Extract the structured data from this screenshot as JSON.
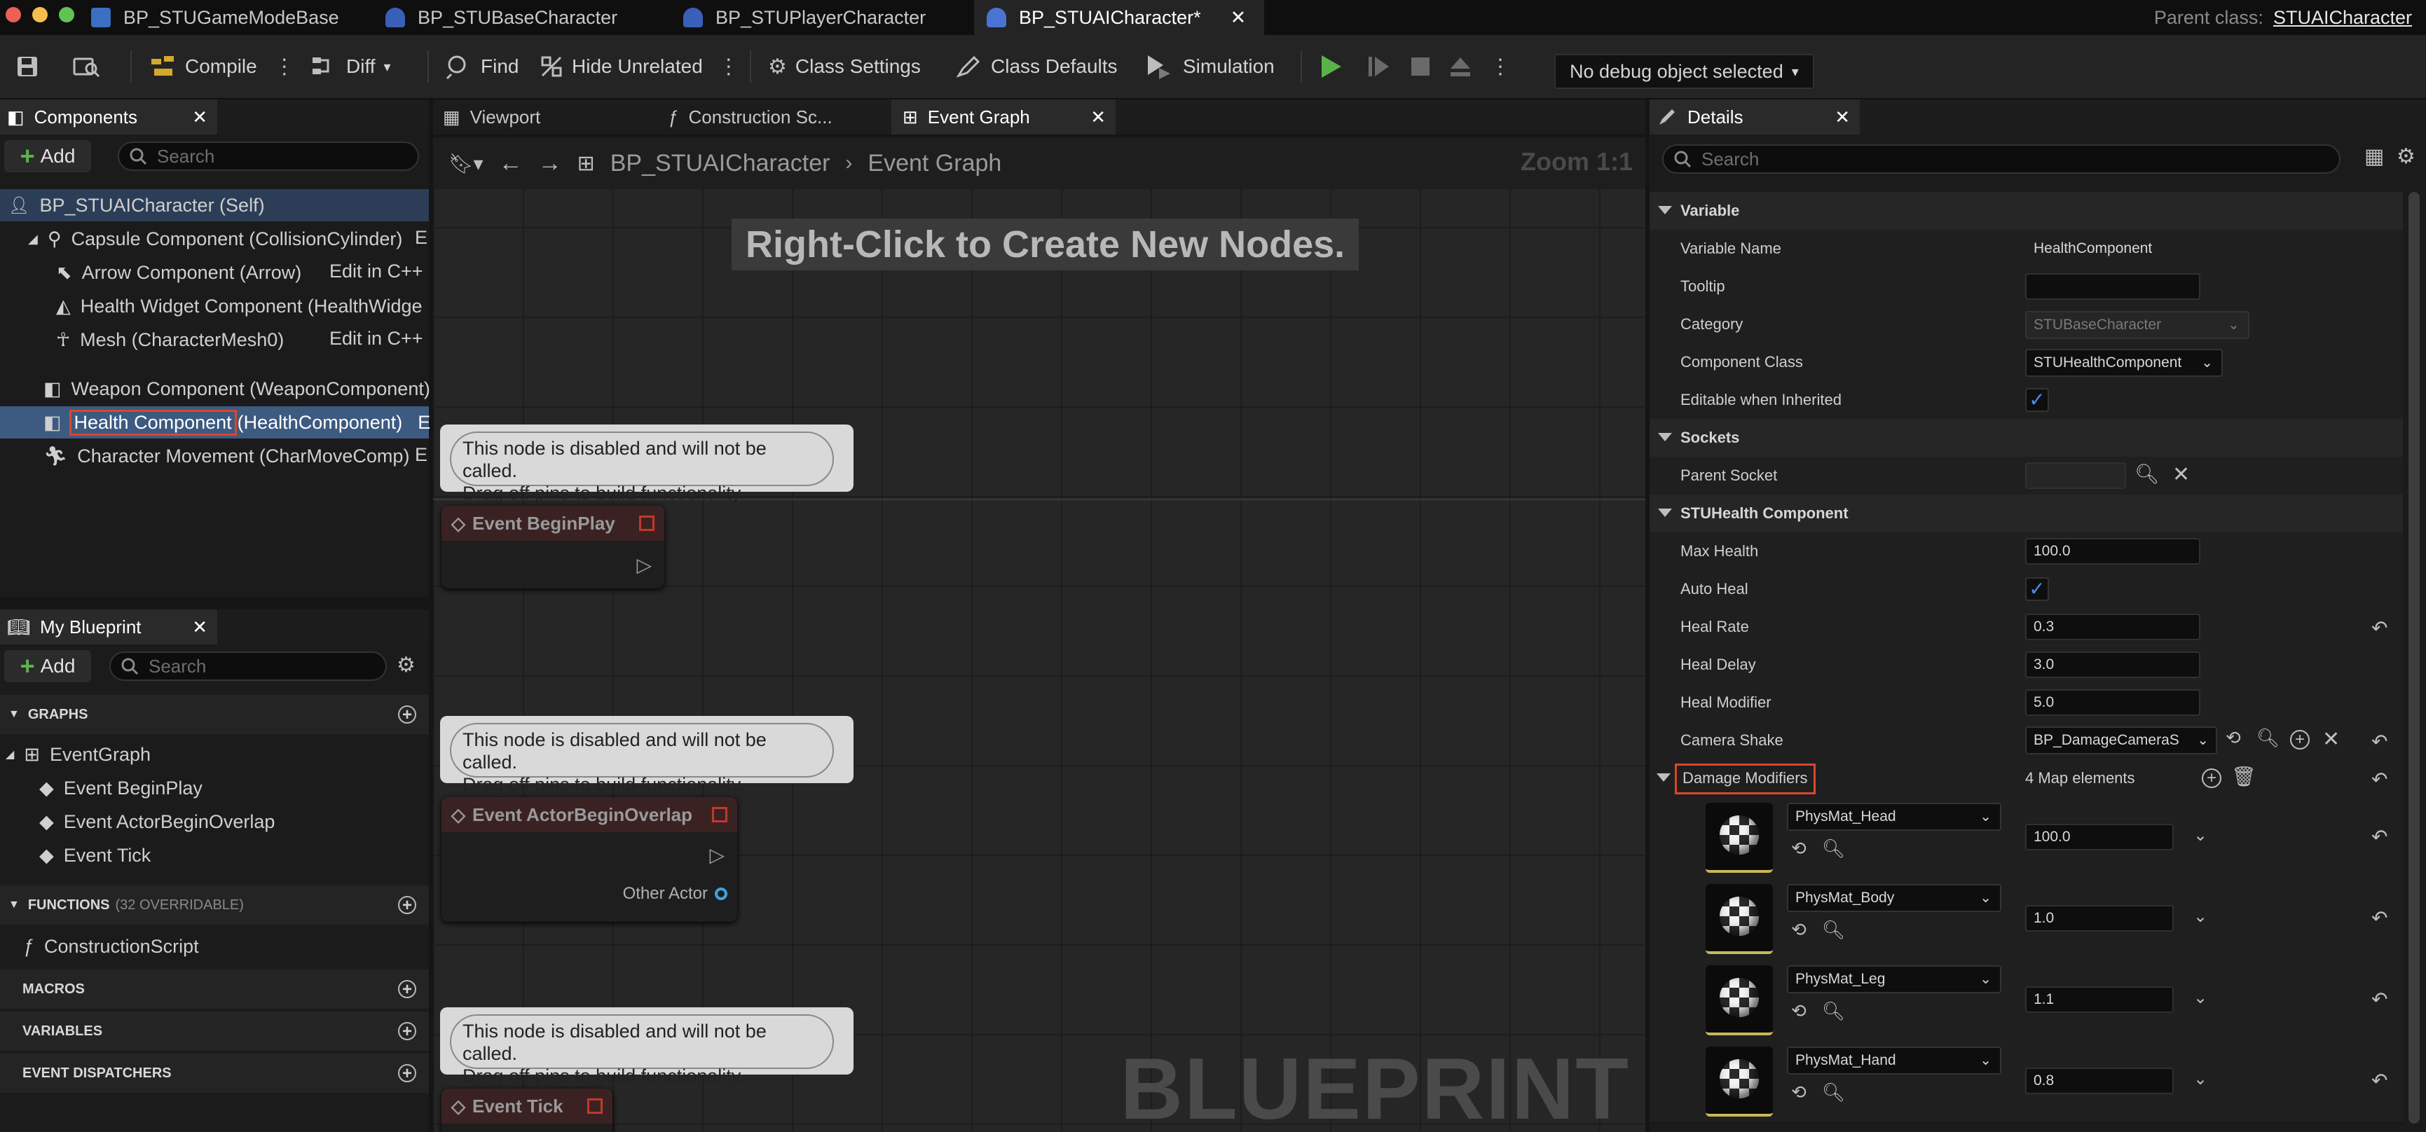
{
  "tabs": [
    {
      "label": "BP_STUGameModeBase",
      "active": false
    },
    {
      "label": "BP_STUBaseCharacter",
      "active": false
    },
    {
      "label": "BP_STUPlayerCharacter",
      "active": false
    },
    {
      "label": "BP_STUAICharacter*",
      "active": true
    }
  ],
  "parent_class": {
    "prefix": "Parent class:",
    "value": "STUAICharacter"
  },
  "toolbar": {
    "compile": "Compile",
    "diff": "Diff",
    "find": "Find",
    "hide_unrelated": "Hide Unrelated",
    "class_settings": "Class Settings",
    "class_defaults": "Class Defaults",
    "simulation": "Simulation",
    "debug_object": "No debug object selected"
  },
  "components": {
    "title": "Components",
    "add": "Add",
    "search_placeholder": "Search",
    "items": [
      {
        "label": "BP_STUAICharacter (Self)"
      },
      {
        "label": "Capsule Component (CollisionCylinder)",
        "extra": "E"
      },
      {
        "label": "Arrow Component (Arrow)",
        "extra": "Edit in C++"
      },
      {
        "label": "Health Widget Component (HealthWidge"
      },
      {
        "label": "Mesh (CharacterMesh0)",
        "extra": "Edit in C++"
      },
      {
        "label": "Weapon Component (WeaponComponent)"
      },
      {
        "label_main": "Health Component",
        "label_paren": "(HealthComponent)",
        "extra": "E"
      },
      {
        "label": "Character Movement (CharMoveComp)",
        "extra": "E"
      }
    ]
  },
  "my_blueprint": {
    "title": "My Blueprint",
    "add": "Add",
    "search_placeholder": "Search",
    "graphs_header": "GRAPHS",
    "event_graph": "EventGraph",
    "events": [
      "Event BeginPlay",
      "Event ActorBeginOverlap",
      "Event Tick"
    ],
    "functions_header": "FUNCTIONS",
    "functions_note": "(32 OVERRIDABLE)",
    "construction_script": "ConstructionScript",
    "macros_header": "MACROS",
    "variables_header": "VARIABLES",
    "dispatchers_header": "EVENT DISPATCHERS"
  },
  "graph": {
    "tabs": [
      "Viewport",
      "Construction Sc...",
      "Event Graph"
    ],
    "breadcrumb_root": "BP_STUAICharacter",
    "breadcrumb_leaf": "Event Graph",
    "zoom": "Zoom 1:1",
    "hint": "Right-Click to Create New Nodes.",
    "note_line1": "This node is disabled and will not be called.",
    "note_line2": "Drag off pins to build functionality.",
    "nodes": [
      "Event BeginPlay",
      "Event ActorBeginOverlap",
      "Event Tick"
    ],
    "pin_other_actor": "Other Actor",
    "watermark": "BLUEPRINT"
  },
  "details": {
    "title": "Details",
    "search_placeholder": "Search",
    "section_variable": "Variable",
    "variable_name_label": "Variable Name",
    "variable_name": "HealthComponent",
    "tooltip_label": "Tooltip",
    "tooltip": "",
    "category_label": "Category",
    "category": "STUBaseCharacter",
    "component_class_label": "Component Class",
    "component_class": "STUHealthComponent",
    "editable_label": "Editable when Inherited",
    "editable": true,
    "section_sockets": "Sockets",
    "parent_socket_label": "Parent Socket",
    "section_health": "STUHealth Component",
    "max_health_label": "Max Health",
    "max_health": "100.0",
    "auto_heal_label": "Auto Heal",
    "auto_heal": true,
    "heal_rate_label": "Heal Rate",
    "heal_rate": "0.3",
    "heal_delay_label": "Heal Delay",
    "heal_delay": "3.0",
    "heal_modifier_label": "Heal Modifier",
    "heal_modifier": "5.0",
    "camera_shake_label": "Camera Shake",
    "camera_shake": "BP_DamageCameraS",
    "damage_modifiers_label": "Damage Modifiers",
    "damage_modifiers_count": "4 Map elements",
    "map": [
      {
        "key": "PhysMat_Head",
        "value": "100.0"
      },
      {
        "key": "PhysMat_Body",
        "value": "1.0"
      },
      {
        "key": "PhysMat_Leg",
        "value": "1.1"
      },
      {
        "key": "PhysMat_Hand",
        "value": "0.8"
      }
    ]
  },
  "colors": {
    "accent_blue": "#4a8cf0",
    "selection": "#3d5a80",
    "highlight_red": "#d9472b",
    "play_green": "#59b34a"
  }
}
